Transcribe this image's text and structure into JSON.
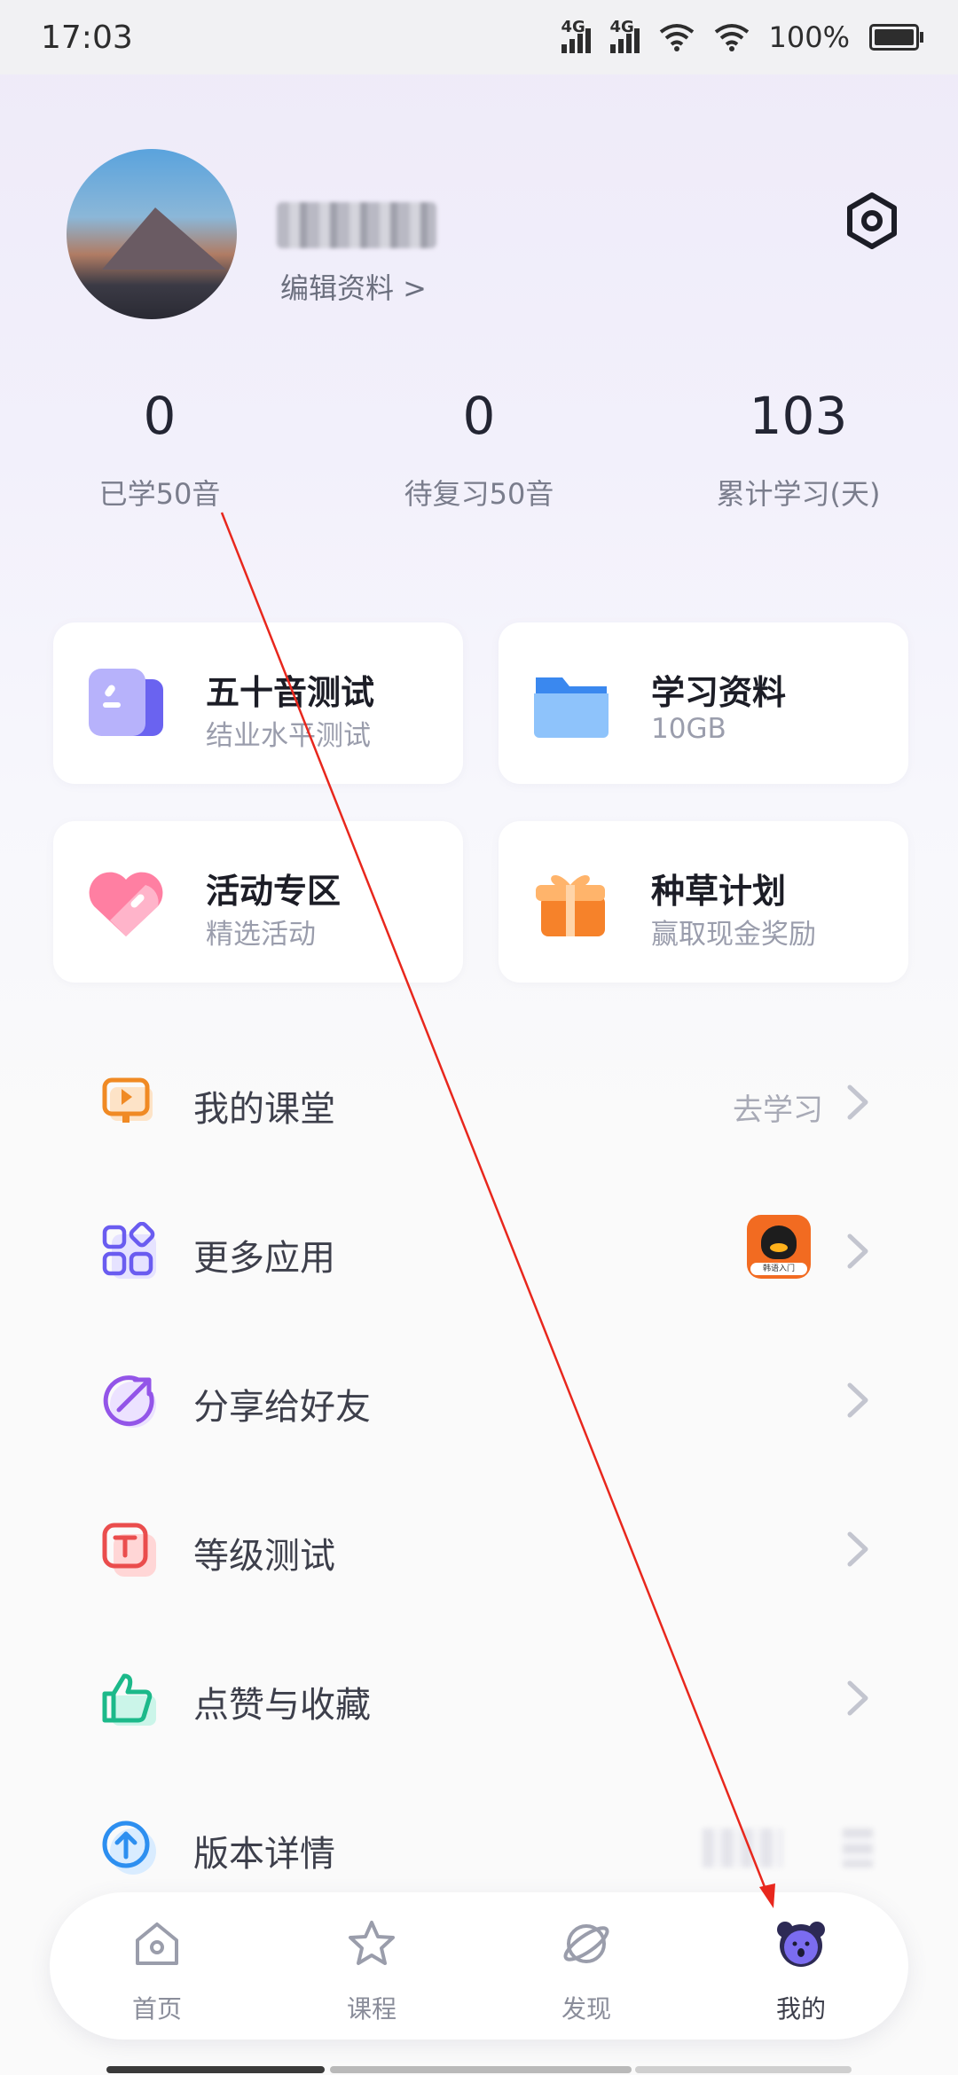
{
  "status_bar": {
    "time": "17:03",
    "signal1": "4G",
    "signal2": "4G",
    "battery": "100%"
  },
  "profile": {
    "edit_label": "编辑资料 >"
  },
  "stats": [
    {
      "value": "0",
      "label": "已学50音"
    },
    {
      "value": "0",
      "label": "待复习50音"
    },
    {
      "value": "103",
      "label": "累计学习(天)"
    }
  ],
  "cards": [
    {
      "title": "五十音测试",
      "subtitle": "结业水平测试",
      "icon": "test-card-icon"
    },
    {
      "title": "学习资料",
      "subtitle": "10GB",
      "icon": "folder-icon"
    },
    {
      "title": "活动专区",
      "subtitle": "精选活动",
      "icon": "heart-icon"
    },
    {
      "title": "种草计划",
      "subtitle": "赢取现金奖励",
      "icon": "gift-icon"
    }
  ],
  "menu": [
    {
      "label": "我的课堂",
      "right_text": "去学习",
      "icon": "classroom-icon"
    },
    {
      "label": "更多应用",
      "right_text": "",
      "icon": "apps-icon",
      "thumb_label": "韩语入门"
    },
    {
      "label": "分享给好友",
      "right_text": "",
      "icon": "share-icon"
    },
    {
      "label": "等级测试",
      "right_text": "",
      "icon": "level-test-icon"
    },
    {
      "label": "点赞与收藏",
      "right_text": "",
      "icon": "thumbs-up-icon"
    },
    {
      "label": "版本详情",
      "right_text": "",
      "icon": "upgrade-icon"
    }
  ],
  "tabs": [
    {
      "label": "首页",
      "icon": "home-icon"
    },
    {
      "label": "课程",
      "icon": "star-icon"
    },
    {
      "label": "发现",
      "icon": "planet-icon"
    },
    {
      "label": "我的",
      "icon": "bear-avatar-icon",
      "active": true
    }
  ],
  "colors": {
    "annotation_arrow": "#e8271d",
    "accent_purple": "#7b6cf0"
  }
}
